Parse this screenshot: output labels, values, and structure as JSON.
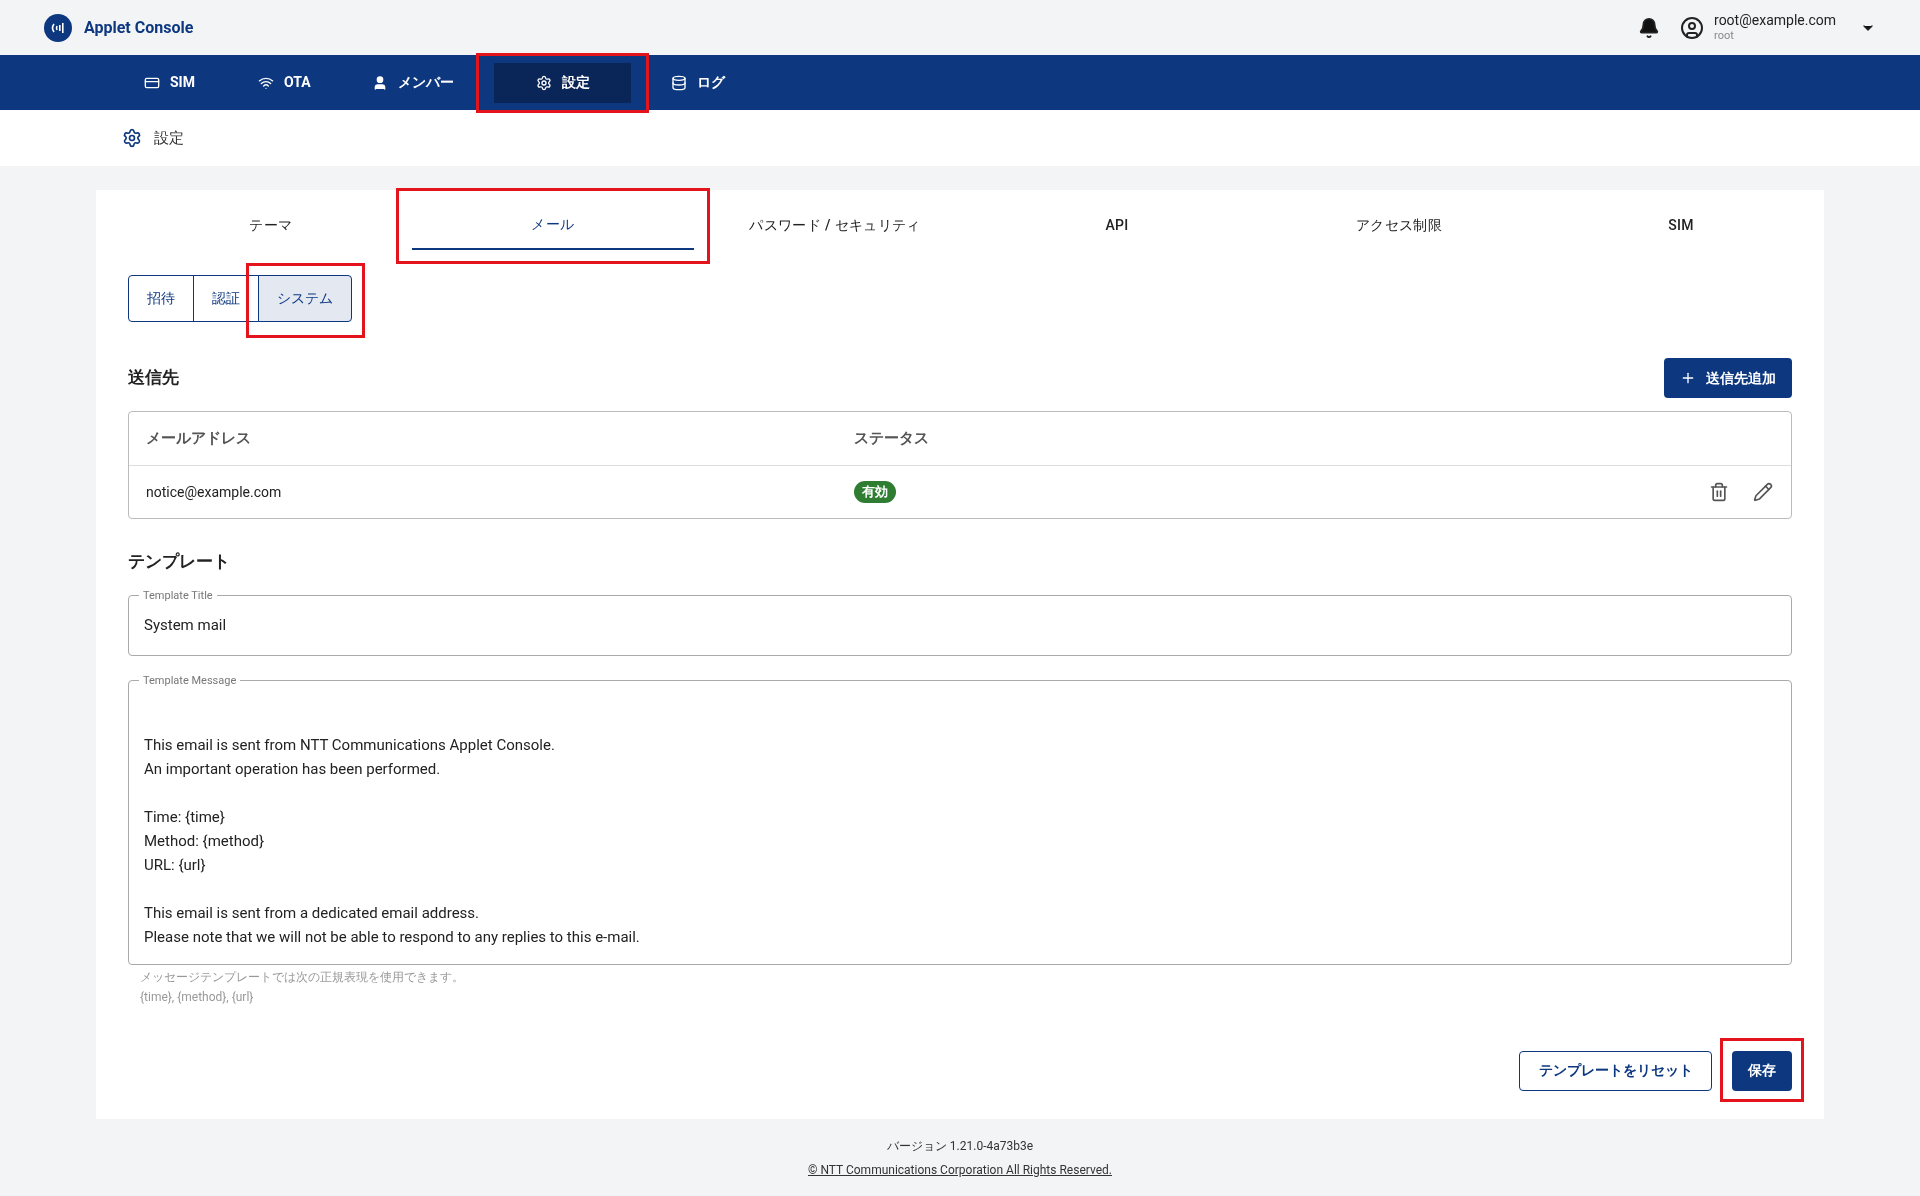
{
  "app": {
    "title": "Applet Console"
  },
  "user": {
    "email": "root@example.com",
    "role": "root"
  },
  "nav": [
    {
      "label": "SIM",
      "selected": false,
      "highlighted": false
    },
    {
      "label": "OTA",
      "selected": false,
      "highlighted": false
    },
    {
      "label": "メンバー",
      "selected": false,
      "highlighted": false
    },
    {
      "label": "設定",
      "selected": true,
      "highlighted": true
    },
    {
      "label": "ログ",
      "selected": false,
      "highlighted": false
    }
  ],
  "breadcrumb": {
    "label": "設定"
  },
  "tabs": [
    {
      "label": "テーマ",
      "selected": false,
      "highlighted": false
    },
    {
      "label": "メール",
      "selected": true,
      "highlighted": true
    },
    {
      "label": "パスワード / セキュリティ",
      "selected": false,
      "highlighted": false
    },
    {
      "label": "API",
      "selected": false,
      "highlighted": false
    },
    {
      "label": "アクセス制限",
      "selected": false,
      "highlighted": false
    },
    {
      "label": "SIM",
      "selected": false,
      "highlighted": false
    }
  ],
  "subtabs": [
    {
      "label": "招待",
      "selected": false,
      "highlighted": false
    },
    {
      "label": "認証",
      "selected": false,
      "highlighted": false
    },
    {
      "label": "システム",
      "selected": true,
      "highlighted": true
    }
  ],
  "recipients": {
    "title": "送信先",
    "add_button": "送信先追加",
    "columns": [
      "メールアドレス",
      "ステータス"
    ],
    "rows": [
      {
        "email": "notice@example.com",
        "status": "有効",
        "color": "#2e7d32"
      }
    ]
  },
  "template": {
    "title": "テンプレート",
    "title_field": {
      "label": "Template Title",
      "value": "System mail"
    },
    "message_field": {
      "label": "Template Message",
      "value": "\n\nThis email is sent from NTT Communications Applet Console.\nAn important operation has been performed.\n\nTime: {time}\nMethod: {method}\nURL: {url}\n\nThis email is sent from a dedicated email address.\nPlease note that we will not be able to respond to any replies to this e-mail."
    },
    "help": [
      "メッセージテンプレートでは次の正規表現を使用できます。",
      "{time}, {method}, {url}"
    ]
  },
  "actions": [
    {
      "label": "テンプレートをリセット",
      "kind": "outline",
      "highlighted": false
    },
    {
      "label": "保存",
      "kind": "primary",
      "highlighted": true
    }
  ],
  "footer": {
    "version": "バージョン 1.21.0-4a73b3e",
    "copyright": "© NTT Communications Corporation All Rights Reserved."
  }
}
